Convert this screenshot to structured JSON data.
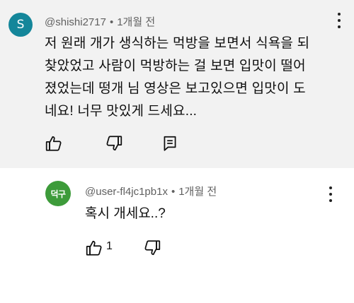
{
  "comment": {
    "avatar_letter": "S",
    "username": "@shishi2717",
    "separator": "•",
    "time": "1개월 전",
    "text_lines": [
      "저 원래 개가 생식하는 먹방을 보면서 식욕을 되",
      "찾았었고 사람이 먹방하는 걸 보면 입맛이 떨어",
      "졌었는데 떵개 님 영상은 보고있으면 입맛이 도",
      "네요! 너무 맛있게 드세요..."
    ],
    "icons": [
      "thumbs-up-icon",
      "thumbs-down-icon",
      "reply-icon",
      "more-vert-icon"
    ]
  },
  "reply": {
    "avatar_text": "덕구",
    "username": "@user-fl4jc1pb1x",
    "separator": "•",
    "time": "1개월 전",
    "text": "혹시 개세요..?",
    "like_count": "1",
    "icons": [
      "thumbs-up-icon",
      "thumbs-down-icon",
      "more-vert-icon"
    ]
  },
  "colors": {
    "top_background": "#f2f2f2",
    "avatar_s": "#14869a",
    "avatar_reply": "#3d9b3a",
    "meta_text": "#606060"
  }
}
